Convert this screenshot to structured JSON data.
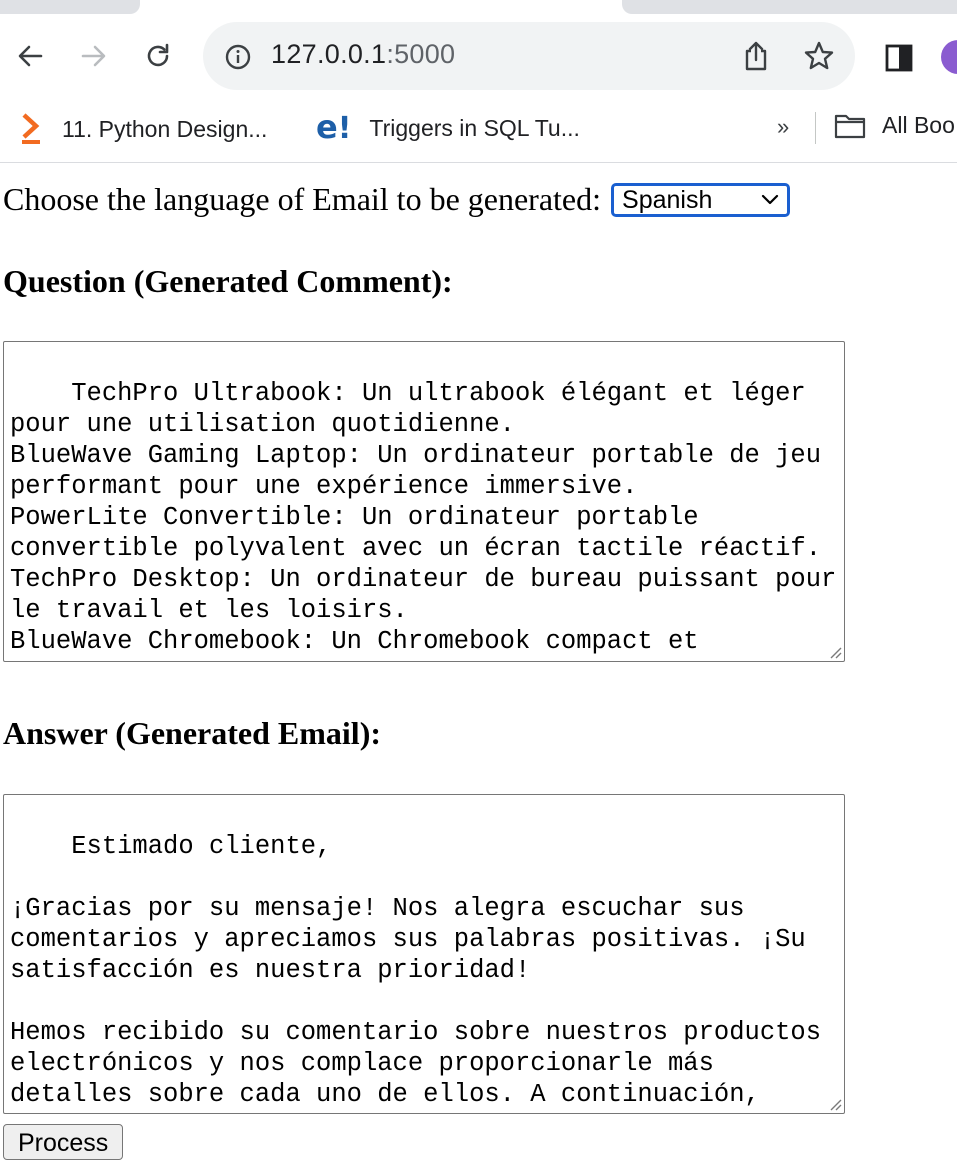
{
  "browser": {
    "url_host": "127.0.0.1",
    "url_port": ":5000",
    "bookmarks": [
      {
        "label": "11. Python Design...",
        "icon": "orange-chevron-icon"
      },
      {
        "label": "Triggers in SQL Tu...",
        "icon": "e-logo-icon"
      }
    ],
    "overflow_label": "»",
    "all_bookmarks_label": "All Boo"
  },
  "form": {
    "language_prompt": "Choose the language of Email to be generated:",
    "language_selected": "Spanish",
    "question_heading": "Question (Generated Comment):",
    "question_text": "TechPro Ultrabook: Un ultrabook élégant et léger pour une utilisation quotidienne.\nBlueWave Gaming Laptop: Un ordinateur portable de jeu performant pour une expérience immersive.\nPowerLite Convertible: Un ordinateur portable convertible polyvalent avec un écran tactile réactif.\nTechPro Desktop: Un ordinateur de bureau puissant pour le travail et les loisirs.\nBlueWave Chromebook: Un Chromebook compact et",
    "answer_heading": "Answer (Generated Email):",
    "answer_text": "Estimado cliente,\n\n¡Gracias por su mensaje! Nos alegra escuchar sus comentarios y apreciamos sus palabras positivas. ¡Su satisfacción es nuestra prioridad!\n\nHemos recibido su comentario sobre nuestros productos electrónicos y nos complace proporcionarle más detalles sobre cada uno de ellos. A continuación, encontrará una descripción de cada",
    "process_label": "Process"
  },
  "colors": {
    "select_focus_border": "#1a5fd0",
    "profile_avatar": "#8a5cd0"
  }
}
